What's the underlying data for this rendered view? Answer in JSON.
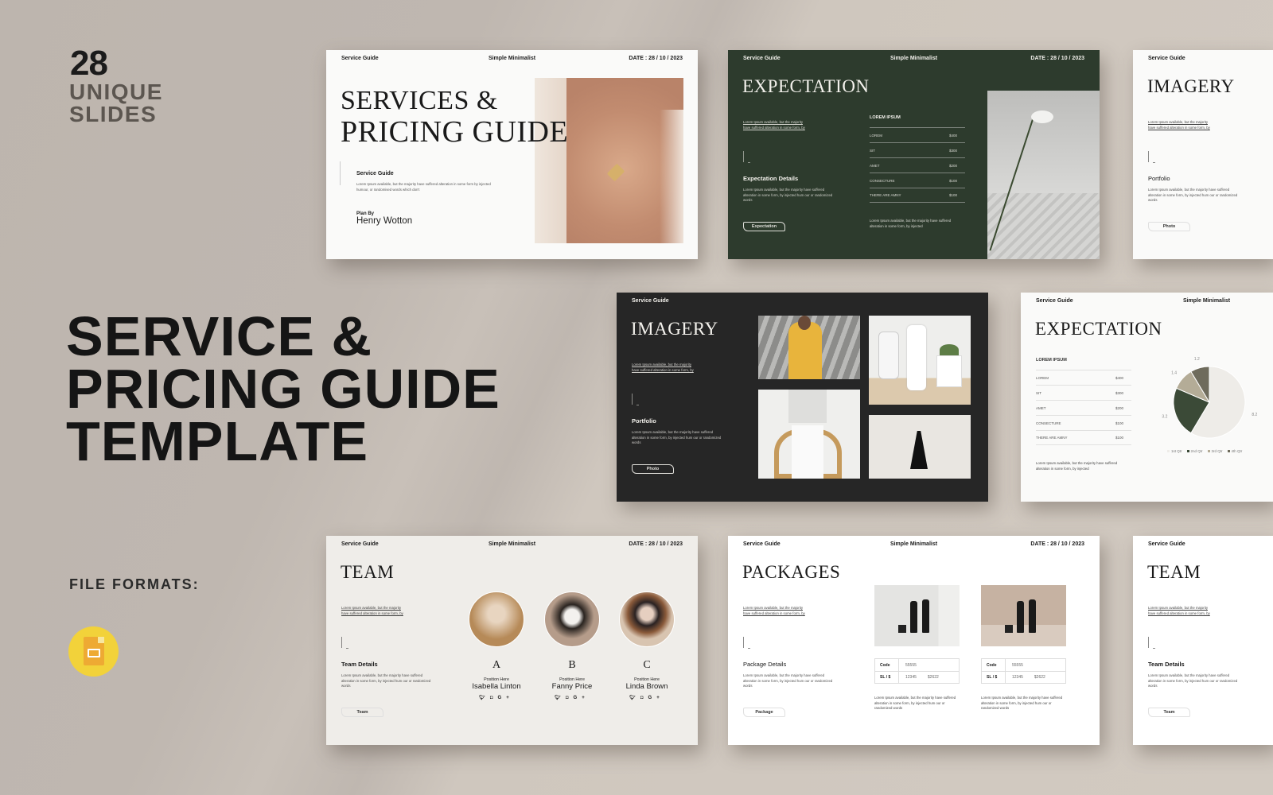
{
  "promo": {
    "count": "28",
    "subtitle_line1": "UNIQUE",
    "subtitle_line2": "SLIDES",
    "title_lines": [
      "SERVICE &",
      "PRICING GUIDE",
      "TEMPLATE"
    ],
    "file_formats_label": "FILE FORMATS:",
    "format_icon": "google-slides-icon"
  },
  "header": {
    "left": "Service Guide",
    "center": "Simple Minimalist",
    "right": "DATE : 28 / 10 / 2023"
  },
  "lorem_link": "Lorem Ipsum available, but the majority have suffered alteration in some form, by",
  "lorem_desc": "Lorem Ipsum available, but the majority have suffered alteration in some form, by injected hum our or randomized words",
  "cover": {
    "title_line1": "SERVICES &",
    "title_line2": "PRICING GUIDE",
    "section": "Service Guide",
    "desc": "Lorem Ipsum available, but the majority have suffered alteration in some form by injected humour, or randomised words which don't",
    "plan_by": "Plan By",
    "author": "Henry Wotton"
  },
  "expectation_green": {
    "title": "EXPECTATION",
    "details_title": "Expectation Details",
    "button": "Expectation"
  },
  "price_table": {
    "title": "LOREM IPSUM",
    "rows": [
      {
        "label": "LOREM",
        "price": "$400"
      },
      {
        "label": "SIT",
        "price": "$300"
      },
      {
        "label": "AMET",
        "price": "$200"
      },
      {
        "label": "CONSECTURE",
        "price": "$100"
      },
      {
        "label": "THERE ARE AMNY",
        "price": "$100"
      }
    ],
    "footnote": "Lorem Ipsum available, but the majority have suffered alteration in some form, by injected"
  },
  "imagery": {
    "title": "IMAGERY",
    "details_title": "Portfolio",
    "button": "Photo"
  },
  "expectation_chart": {
    "title": "EXPECTATION"
  },
  "chart_data": {
    "type": "pie",
    "categories": [
      "1st Qtr",
      "2nd Qtr",
      "3rd Qtr",
      "4th Qtr"
    ],
    "values": [
      8.2,
      3.2,
      1.4,
      1.2
    ],
    "colors": [
      "#eeece8",
      "#3b4a37",
      "#b4ac97",
      "#6e6b5c"
    ],
    "legend": "bottom"
  },
  "team": {
    "title": "TEAM",
    "details_title": "Team Details",
    "button": "Team",
    "members": [
      {
        "letter": "A",
        "position": "Position Here",
        "name": "Isabella Linton"
      },
      {
        "letter": "B",
        "position": "Position Here",
        "name": "Fanny Price"
      },
      {
        "letter": "C",
        "position": "Position Here",
        "name": "Linda Brown"
      }
    ],
    "social_icons": [
      "twitter-icon",
      "instagram-icon",
      "google-plus-icon"
    ]
  },
  "packages": {
    "title": "PACKAGES",
    "details_title": "Package Details",
    "button": "Package",
    "items": [
      {
        "code_label": "Code",
        "code": "55555",
        "sl_label": "SL / $",
        "sl": "12345",
        "price": "$2622"
      },
      {
        "code_label": "Code",
        "code": "55555",
        "sl_label": "SL / $",
        "sl": "12345",
        "price": "$2622"
      }
    ]
  },
  "colors": {
    "green_slide": "#2d3b2d",
    "dark_slide": "#262626",
    "icon_yellow": "#f2d23a"
  }
}
